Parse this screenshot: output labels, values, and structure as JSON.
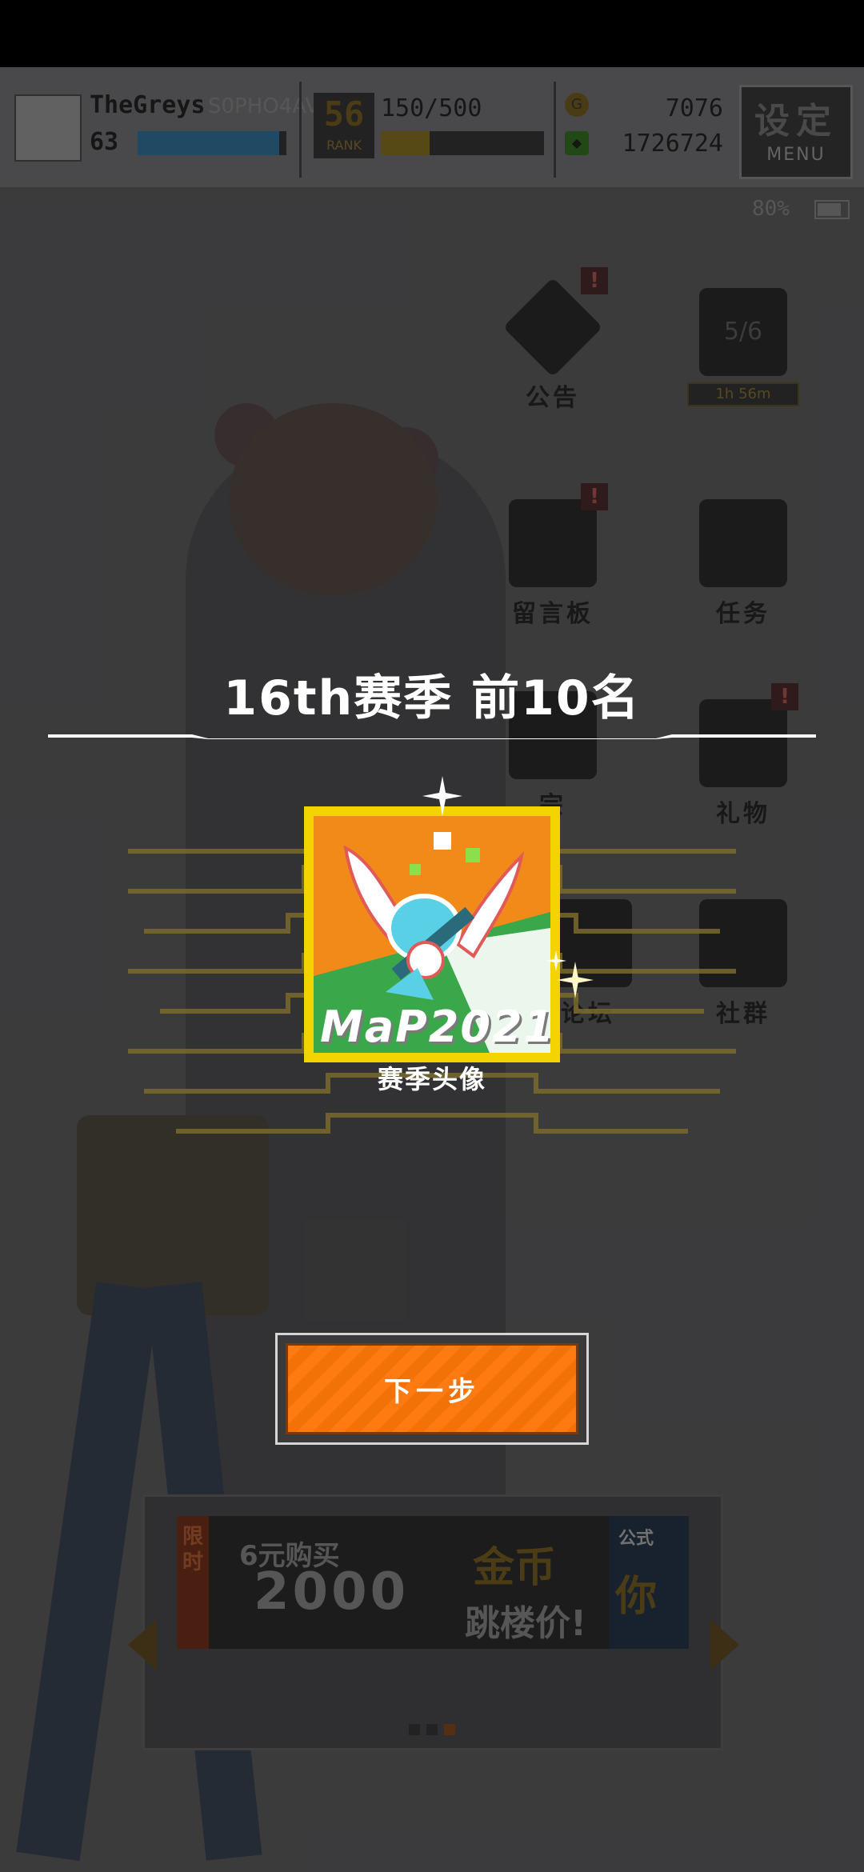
{
  "player": {
    "name": "TheGreys",
    "id": "S0PHO4AVH",
    "level": "63",
    "exp_fraction": 0.95
  },
  "rank": {
    "value": "56",
    "label": "RANK"
  },
  "stamina": {
    "text": "150/500",
    "fraction": 0.3
  },
  "currency": {
    "gold": "7076",
    "gems": "1726724"
  },
  "settings": {
    "label": "设定",
    "sub": "MENU"
  },
  "battery": {
    "text": "80%",
    "fraction": 0.8
  },
  "menu": {
    "notice": "公告",
    "quest_progress": "5/6",
    "quest_timer": "1h 56m",
    "board": "留言板",
    "tasks": "任务",
    "gifts": "礼物",
    "community": "社群",
    "partial_label_1": "宗",
    "partial_label_2": "论坛"
  },
  "reward": {
    "title": "16th赛季  前10名",
    "item_art_label": "MaP2021",
    "item_name": "赛季头像",
    "next_button": "下一步"
  },
  "banner": {
    "tag": "限时",
    "price_text": "6元购买",
    "amount": "2000",
    "coins_text": "金币",
    "sale_text": "跳楼价!",
    "side_top": "公式",
    "side_text": "你",
    "page_count": 3,
    "active_page": 3
  },
  "colors": {
    "accent_orange": "#ff7a10",
    "badge_yellow": "#f3d400",
    "title_white": "#ffffff"
  }
}
